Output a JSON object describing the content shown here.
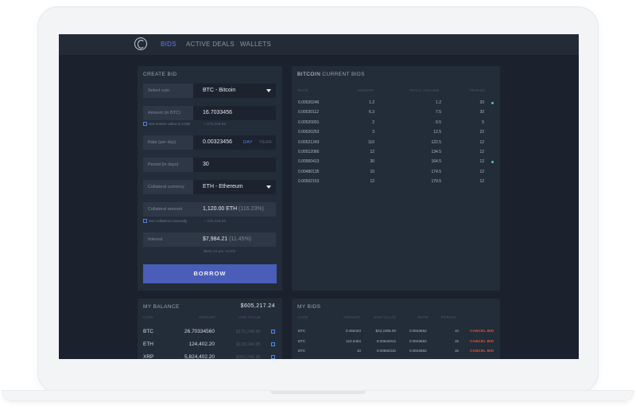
{
  "nav": {
    "tabs": [
      {
        "label": "BIDS",
        "active": true
      },
      {
        "label": "ACTIVE DEALS",
        "active": false
      },
      {
        "label": "WALLETS",
        "active": false
      }
    ]
  },
  "create_bid": {
    "title": "CREATE BID",
    "select_coin_label": "Select coin",
    "select_coin_value": "BTC - Bitcoin",
    "amount_label": "Amount (in BTC)",
    "amount_value": "16.7033456",
    "set_motion_label": "Set motion value in USD",
    "amount_usd_note": "~ 272,246.95",
    "rate_label": "Rate (per day)",
    "rate_value": "0.00323456",
    "rate_day": "DAY",
    "rate_year": "YEAR",
    "period_label": "Period (in days)",
    "period_value": "30",
    "collateral_currency_label": "Collateral currency",
    "collateral_currency_value": "ETH - Ethereum",
    "collateral_amount_label": "Collateral amount",
    "collateral_amount_value": "1,120.00 ETH",
    "collateral_amount_pct": "(116.23%)",
    "set_collateral_label": "Set collateral manually",
    "collateral_usd_note": "~ 316,246.95",
    "interest_label": "Interest",
    "interest_value": "$7,984.21",
    "interest_pct": "(11.45%)",
    "interest_note": "$665.34 per month",
    "borrow_label": "BORROW"
  },
  "current_bids": {
    "title_bold": "BITCOIN",
    "title_rest": " CURRENT BIDS",
    "columns": [
      "RATE",
      "AMOUNT",
      "TOTAL VOLUME",
      "PERIOD"
    ],
    "rows": [
      {
        "rate": "0.00520246",
        "amount": "1.2",
        "total": "1.2",
        "period": "20",
        "dot": true
      },
      {
        "rate": "0.00530112",
        "amount": "6.3",
        "total": "7.5",
        "period": "30",
        "dot": false
      },
      {
        "rate": "0.00520001",
        "amount": "2",
        "total": "9.5",
        "period": "5",
        "dot": false
      },
      {
        "rate": "0.00520253",
        "amount": "3",
        "total": "12.5",
        "period": "22",
        "dot": false
      },
      {
        "rate": "0.00521243",
        "amount": "110",
        "total": "122.5",
        "period": "12",
        "dot": false
      },
      {
        "rate": "0.00512066",
        "amount": "12",
        "total": "134.5",
        "period": "12",
        "dot": false
      },
      {
        "rate": "0.00560413",
        "amount": "30",
        "total": "164.5",
        "period": "12",
        "dot": true
      },
      {
        "rate": "0.00480135",
        "amount": "10",
        "total": "174.5",
        "period": "12",
        "dot": false
      },
      {
        "rate": "0.00502153",
        "amount": "12",
        "total": "179.5",
        "period": "12",
        "dot": false
      }
    ]
  },
  "my_balance": {
    "title": "MY BALANCE",
    "total": "$605,217.24",
    "columns": [
      "COIN",
      "AMOUNT",
      "USD VALUE"
    ],
    "rows": [
      {
        "coin": "BTC",
        "amount": "26.70334560",
        "usd": "$176,246.95"
      },
      {
        "coin": "ETH",
        "amount": "124,402.20",
        "usd": "$128,246.95"
      },
      {
        "coin": "XRP",
        "amount": "5,824,402.20",
        "usd": "$303,246.95"
      }
    ]
  },
  "my_bids": {
    "title": "MY BIDS",
    "columns": [
      "COIN",
      "AMOUNT",
      "USD VALUE",
      "RATE",
      "PERIOD"
    ],
    "rows": [
      {
        "coin": "BTC",
        "amount": "0.456423",
        "usd": "$22,2305.00",
        "rate": "0.0043562",
        "period": "10",
        "action": "CANCEL BID"
      },
      {
        "coin": "BTC",
        "amount": "124.5464",
        "usd": "0.00542012",
        "rate": "0.0043562",
        "period": "15",
        "action": "CANCEL BID"
      },
      {
        "coin": "BTC",
        "amount": "10",
        "usd": "0.00582315",
        "rate": "0.0043562",
        "period": "15",
        "action": "CANCEL BID"
      }
    ]
  },
  "colors": {
    "accent": "#5f7ee0",
    "button": "#4a5db8",
    "cancel": "#e8542f",
    "dot": "#3ed3a0",
    "background": "#1b222d",
    "panel": "#232c39"
  },
  "icons": [
    "app-logo-icon",
    "dropdown-caret-icon",
    "checkbox-icon",
    "external-link-icon",
    "status-dot-icon"
  ]
}
